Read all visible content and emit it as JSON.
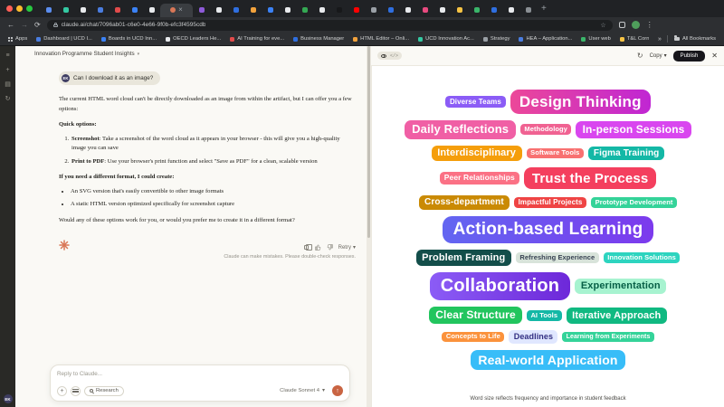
{
  "browser": {
    "traffic_lights": [
      "#ff5f57",
      "#febc2e",
      "#28c840"
    ],
    "tabs": [
      {
        "c": "#5b8def"
      },
      {
        "c": "#34c9a3"
      },
      {
        "c": "#e8eaed"
      },
      {
        "c": "#4a7de0"
      },
      {
        "c": "#e14b4b"
      },
      {
        "c": "#3b82f6"
      },
      {
        "c": "#e8eaed"
      },
      {
        "c": "#d97757",
        "active": true
      },
      {
        "c": "#8e5bd9"
      },
      {
        "c": "#e8eaed"
      },
      {
        "c": "#2f6fe0"
      },
      {
        "c": "#f2a23c"
      },
      {
        "c": "#3b82f6"
      },
      {
        "c": "#e8eaed"
      },
      {
        "c": "#34a853"
      },
      {
        "c": "#e8eaed"
      },
      {
        "c": "#17181a"
      },
      {
        "c": "#ff0000"
      },
      {
        "c": "#9aa0a6"
      },
      {
        "c": "#2f6fe0"
      },
      {
        "c": "#e8eaed"
      },
      {
        "c": "#e84a7f"
      },
      {
        "c": "#e8eaed"
      },
      {
        "c": "#f6c344"
      },
      {
        "c": "#3ab56a"
      },
      {
        "c": "#2f6fe0"
      },
      {
        "c": "#e8eaed"
      },
      {
        "c": "#8a8f94"
      }
    ],
    "close_glyph": "×",
    "new_tab_glyph": "+",
    "back": "←",
    "forward": "→",
    "reload": "⟳",
    "url": "claude.ai/chat/7096ab01-c6e0-4e66-9f0b-efc3f4595cdb",
    "star": "☆",
    "menu_glyph": "⋮",
    "bookmarks": [
      {
        "l": "Dashboard | UCD I...",
        "c": "#4a7de0"
      },
      {
        "l": "Boards in UCD Inn...",
        "c": "#3b82f6"
      },
      {
        "l": "OECD Leaders He...",
        "c": "#e8eaed"
      },
      {
        "l": "AI Training for eve...",
        "c": "#e14b4b"
      },
      {
        "l": "Business Manager",
        "c": "#2f6fe0"
      },
      {
        "l": "HTML Editor – Onli...",
        "c": "#f2a23c"
      },
      {
        "l": "UCD Innovation Ac...",
        "c": "#34c9a3"
      },
      {
        "l": "Strategy",
        "c": "#9aa0a6"
      },
      {
        "l": "HEA – Application...",
        "c": "#4a7de0"
      },
      {
        "l": "User web",
        "c": "#3ab56a"
      },
      {
        "l": "T&L Corner",
        "c": "#f6c344"
      }
    ],
    "apps_label": "Apps",
    "overflow_glyph": "»",
    "all_bookmarks": "All Bookmarks"
  },
  "sidebar": {
    "icons": [
      "≡",
      "+",
      "▤",
      "↻"
    ],
    "avatar": "EK"
  },
  "chat": {
    "title": "Innovation Programme Student Insights",
    "title_chevron": "▾",
    "user_avatar": "EK",
    "user_message": "Can I download it as an image?",
    "response": {
      "p1": "The current HTML word cloud can't be directly downloaded as an image from within the artifact, but I can offer you a few options:",
      "h1": "Quick options:",
      "numbered": [
        {
          "bold": "Screenshot",
          "rest": ": Take a screenshot of the word cloud as it appears in your browser - this will give you a high-quality image you can save"
        },
        {
          "bold": "Print to PDF",
          "rest": ": Use your browser's print function and select \"Save as PDF\" for a clean, scalable version"
        }
      ],
      "h2": "If you need a different format, I could create:",
      "bullets": [
        "An SVG version that's easily convertible to other image formats",
        "A static HTML version optimized specifically for screenshot capture"
      ],
      "p2": "Would any of these options work for you, or would you prefer me to create it in a different format?"
    },
    "retry_label": "Retry",
    "retry_chevron": "▾",
    "disclaimer": "Claude can make mistakes. Please double-check responses.",
    "composer": {
      "placeholder": "Reply to Claude...",
      "plus_glyph": "+",
      "research_label": "Research",
      "model_label": "Claude Sonnet 4",
      "model_chevron": "▾",
      "send_glyph": "↑"
    },
    "accent_color": "#c96442"
  },
  "artifact": {
    "code_toggle_glyph": "</>",
    "history_glyph": "↻",
    "copy_label": "Copy",
    "copy_chevron": "▾",
    "publish_label": "Publish",
    "close_glyph": "✕",
    "footer": "Word size reflects frequency and importance in student feedback",
    "rows": [
      [
        {
          "t": "Diverse Teams",
          "bg": "#8b5cf6",
          "fs": 8
        },
        {
          "t": "Design Thinking",
          "bg": "linear-gradient(90deg,#ec4899,#c026d3)",
          "fs": 17
        }
      ],
      [
        {
          "t": "Daily Reflections",
          "bg": "#f05fa5",
          "fs": 13
        },
        {
          "t": "Methodology",
          "bg": "#f06292",
          "fs": 7.5
        },
        {
          "t": "In-person Sessions",
          "bg": "#d946ef",
          "fs": 12
        }
      ],
      [
        {
          "t": "Interdisciplinary",
          "bg": "#f59e0b",
          "fs": 11
        },
        {
          "t": "Software Tools",
          "bg": "#f87171",
          "fs": 7.5
        },
        {
          "t": "Figma Training",
          "bg": "#14b8a6",
          "fs": 10
        }
      ],
      [
        {
          "t": "Peer Relationships",
          "bg": "#fb7185",
          "fs": 8.5
        },
        {
          "t": "Trust the Process",
          "bg": "#f43f5e",
          "fs": 15
        }
      ],
      [
        {
          "t": "Cross-department",
          "bg": "#ca8a04",
          "fs": 10
        },
        {
          "t": "Impactful Projects",
          "bg": "#ef4444",
          "fs": 8
        },
        {
          "t": "Prototype Development",
          "bg": "#34d399",
          "fs": 7.5
        }
      ],
      [
        {
          "t": "Action-based Learning",
          "bg": "linear-gradient(90deg,#6366f1,#7c3aed)",
          "fs": 19
        }
      ],
      [
        {
          "t": "Problem Framing",
          "bg": "#134e4a",
          "fs": 11
        },
        {
          "t": "Refreshing Experience",
          "bg": "#d8e3da",
          "fg": "#374151",
          "fs": 7.5
        },
        {
          "t": "Innovation Solutions",
          "bg": "#2dd4bf",
          "fs": 7.5
        }
      ],
      [
        {
          "t": "Collaboration",
          "bg": "linear-gradient(90deg,#8b5cf6,#6d28d9)",
          "fs": 20
        },
        {
          "t": "Experimentation",
          "bg": "#a7f3d0",
          "fg": "#065f46",
          "fs": 11
        }
      ],
      [
        {
          "t": "Clear Structure",
          "bg": "#22c55e",
          "fs": 12
        },
        {
          "t": "AI Tools",
          "bg": "#14b8a6",
          "fs": 7.5
        },
        {
          "t": "Iterative Approach",
          "bg": "#10b981",
          "fs": 11
        }
      ],
      [
        {
          "t": "Concepts to Life",
          "bg": "#fb923c",
          "fs": 7.5
        },
        {
          "t": "Deadlines",
          "bg": "#e0e7ff",
          "fg": "#312e81",
          "fs": 9
        },
        {
          "t": "Learning from Experiments",
          "bg": "#34d399",
          "fs": 7
        }
      ],
      [
        {
          "t": "Real-world Application",
          "bg": "#38bdf8",
          "fs": 14
        }
      ]
    ]
  }
}
